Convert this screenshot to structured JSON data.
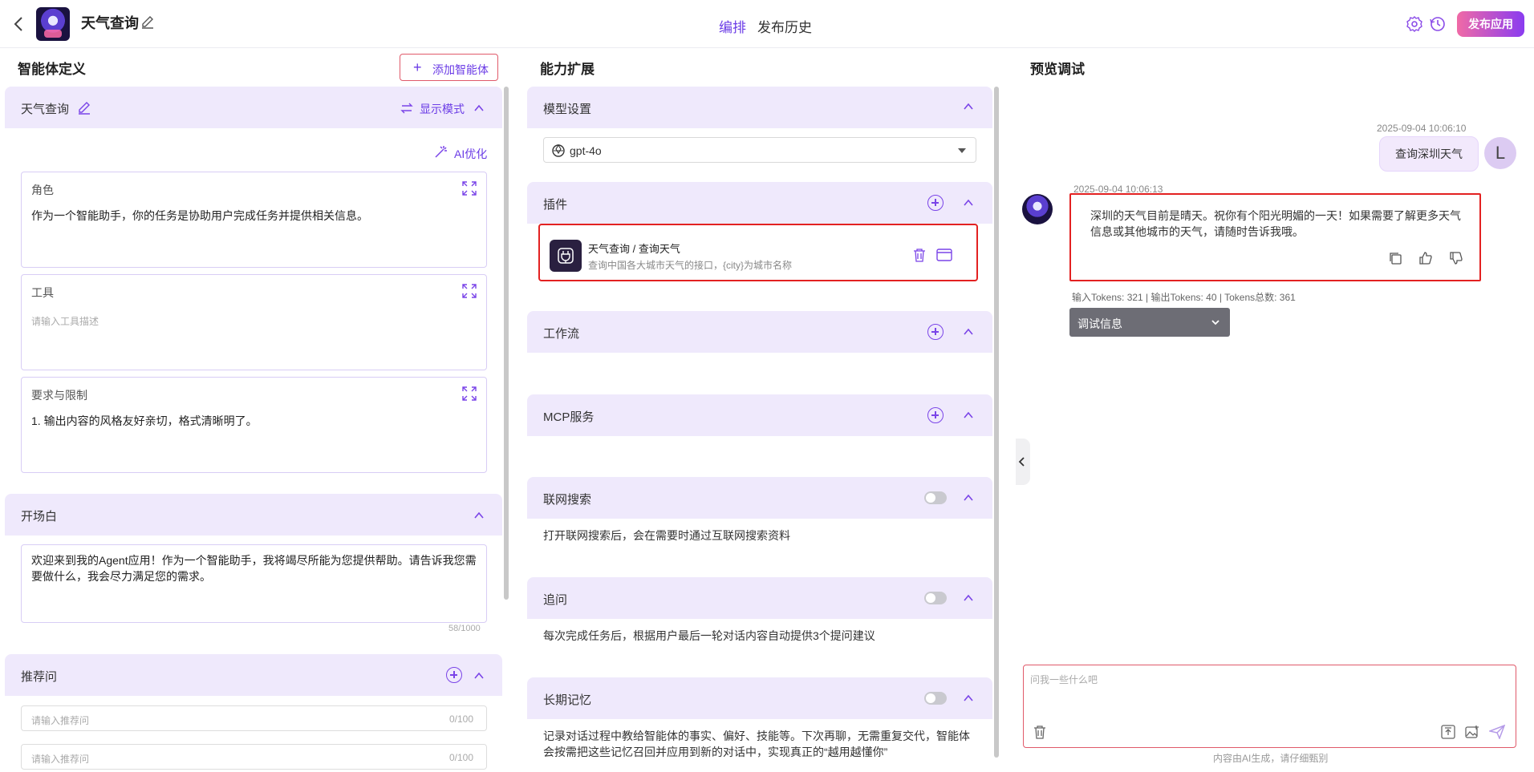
{
  "header": {
    "app_title": "天气查询",
    "tabs": [
      "编排",
      "发布历史"
    ],
    "active_tab": "编排",
    "publish_label": "发布应用",
    "accent_color": "#6b3ce6"
  },
  "agent_def": {
    "title": "智能体定义",
    "add_agent_label": "添加智能体",
    "panel_title": "天气查询",
    "display_mode_label": "显示模式",
    "ai_optimize_label": "AI优化",
    "role": {
      "label": "角色",
      "value": "作为一个智能助手，你的任务是协助用户完成任务并提供相关信息。"
    },
    "tools": {
      "label": "工具",
      "placeholder": "请输入工具描述"
    },
    "constraints": {
      "label": "要求与限制",
      "value": "1. 输出内容的风格友好亲切，格式清晰明了。"
    }
  },
  "opening": {
    "title": "开场白",
    "value": "欢迎来到我的Agent应用！作为一个智能助手，我将竭尽所能为您提供帮助。请告诉我您需要做什么，我会尽力满足您的需求。",
    "counter": "58/1000"
  },
  "suggested": {
    "title": "推荐问",
    "placeholder": "请输入推荐问",
    "counter": "0/100"
  },
  "capabilities": {
    "title": "能力扩展",
    "model": {
      "title": "模型设置",
      "selected": "gpt-4o"
    },
    "plugins": {
      "title": "插件",
      "item_title": "天气查询 / 查询天气",
      "item_desc": "查询中国各大城市天气的接口，{city}为城市名称"
    },
    "workflow": {
      "title": "工作流"
    },
    "mcp": {
      "title": "MCP服务"
    },
    "web_search": {
      "title": "联网搜索",
      "enabled": false,
      "desc": "打开联网搜索后，会在需要时通过互联网搜索资料"
    },
    "followup": {
      "title": "追问",
      "enabled": false,
      "desc": "每次完成任务后，根据用户最后一轮对话内容自动提供3个提问建议"
    },
    "memory": {
      "title": "长期记忆",
      "enabled": false,
      "desc_line1": "记录对话过程中教给智能体的事实、偏好、技能等。下次再聊，无需重复交代，智能体",
      "desc_line2": "会按需把这些记忆召回并应用到新的对话中，实现真正的“越用越懂你”"
    }
  },
  "preview": {
    "title": "预览调试",
    "user_time": "2025-09-04 10:06:10",
    "user_message": "查询深圳天气",
    "user_avatar_letter": "L",
    "bot_time": "2025-09-04 10:06:13",
    "bot_message": "深圳的天气目前是晴天。祝你有个阳光明媚的一天！如果需要了解更多天气信息或其他城市的天气，请随时告诉我哦。",
    "tokens": "输入Tokens: 321 |  输出Tokens: 40 |  Tokens总数: 361",
    "debug_label": "调试信息",
    "input_placeholder": "问我一些什么吧",
    "ai_note": "内容由AI生成，请仔细甄别"
  }
}
